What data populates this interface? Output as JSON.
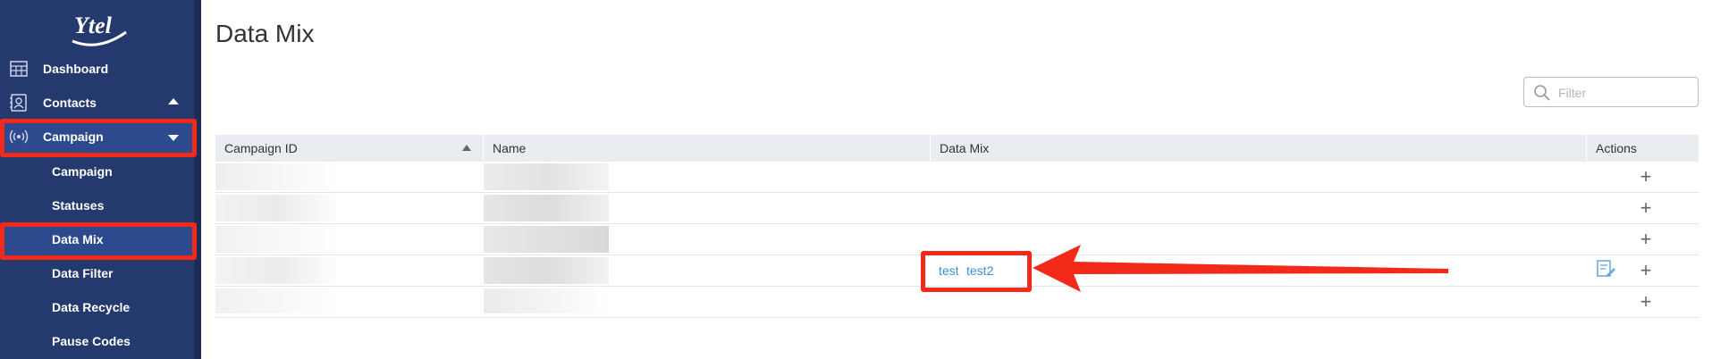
{
  "logo": {
    "text": "Ytel"
  },
  "sidebar": {
    "items": [
      {
        "label": "Dashboard",
        "icon": "dashboard-icon"
      },
      {
        "label": "Contacts",
        "icon": "contacts-icon",
        "caret": "up"
      },
      {
        "label": "Campaign",
        "icon": "broadcast-icon",
        "caret": "down",
        "active": true
      }
    ],
    "sub_items": [
      {
        "label": "Campaign"
      },
      {
        "label": "Statuses"
      },
      {
        "label": "Data Mix",
        "active": true
      },
      {
        "label": "Data Filter"
      },
      {
        "label": "Data Recycle"
      },
      {
        "label": "Pause Codes"
      }
    ]
  },
  "main": {
    "title": "Data Mix",
    "filter": {
      "placeholder": "Filter",
      "value": ""
    },
    "table": {
      "columns": [
        {
          "label": "Campaign ID",
          "sort": "ascending"
        },
        {
          "label": "Name"
        },
        {
          "label": "Data Mix"
        },
        {
          "label": "Actions"
        }
      ],
      "rows": [
        {
          "campaign_id": "",
          "name": "",
          "data_mix": [],
          "edit_icon": false
        },
        {
          "campaign_id": "",
          "name": "",
          "data_mix": [],
          "edit_icon": false
        },
        {
          "campaign_id": "",
          "name": "",
          "data_mix": [],
          "edit_icon": false
        },
        {
          "campaign_id": "",
          "name": "",
          "data_mix": [
            "test",
            "test2"
          ],
          "edit_icon": true
        },
        {
          "campaign_id": "",
          "name": "",
          "data_mix": [],
          "edit_icon": false
        }
      ],
      "add_symbol": "+"
    }
  },
  "colors": {
    "sidebar_bg": "#243a6e",
    "sidebar_active": "#2e4a8e",
    "annotation_red": "#f32a1a",
    "link_blue": "#3a8fd8",
    "header_bg": "#e9edf1"
  }
}
